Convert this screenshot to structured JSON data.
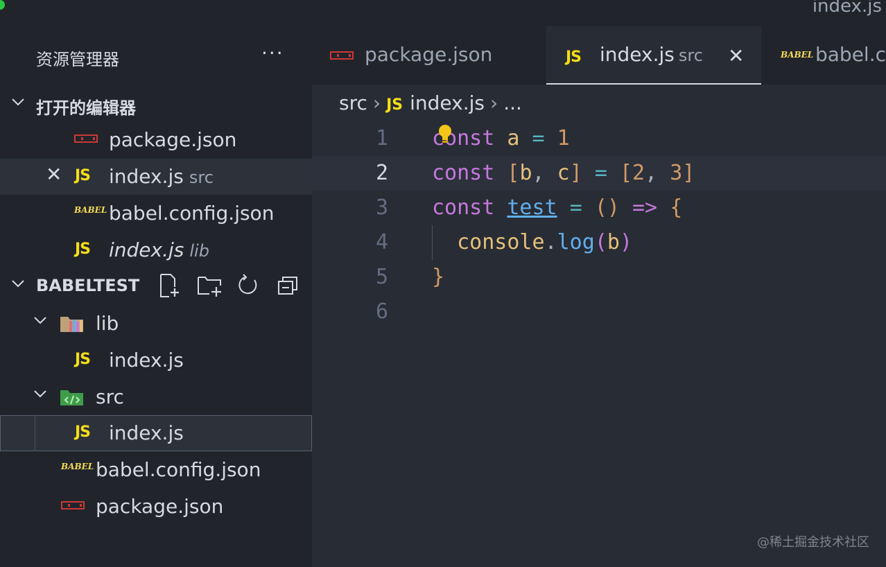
{
  "window": {
    "title": "index.js"
  },
  "sidebar": {
    "title": "资源管理器",
    "more_label": "···",
    "open_editors": {
      "label": "打开的编辑器",
      "items": [
        {
          "name": "package.json",
          "desc": "",
          "icon": "npm-icon"
        },
        {
          "name": "index.js",
          "desc": "src",
          "icon": "js-icon"
        },
        {
          "name": "babel.config.json",
          "desc": "",
          "icon": "babel-icon"
        },
        {
          "name": "index.js",
          "desc": "lib",
          "icon": "js-icon"
        }
      ]
    },
    "project": {
      "label": "BABELTEST",
      "tree": [
        {
          "name": "lib",
          "type": "folder"
        },
        {
          "name": "index.js",
          "type": "file"
        },
        {
          "name": "src",
          "type": "folder"
        },
        {
          "name": "index.js",
          "type": "file"
        },
        {
          "name": "babel.config.json",
          "type": "file"
        },
        {
          "name": "package.json",
          "type": "file"
        }
      ]
    }
  },
  "tabs": [
    {
      "name": "package.json",
      "desc": ""
    },
    {
      "name": "index.js",
      "desc": "src"
    },
    {
      "name": "babel.config.json",
      "desc": ""
    }
  ],
  "icons": {
    "js": "JS",
    "babel": "BABEL",
    "close": "✕",
    "chevron": "›",
    "chevron_down": "⌄"
  },
  "breadcrumb": {
    "folder": "src",
    "file": "index.js",
    "more": "..."
  },
  "editor": {
    "line_numbers": [
      "1",
      "2",
      "3",
      "4",
      "5",
      "6"
    ],
    "current_line": 2,
    "lines": [
      "const a = 1",
      "const [b, c] = [2, 3]",
      "const test = () => {",
      "  console.log(b)",
      "}",
      ""
    ]
  },
  "watermark": "@稀土掘金技术社区",
  "colors": {
    "sidebar_bg": "#21252b",
    "editor_bg": "#282c34",
    "keyword": "#c678dd",
    "variable": "#e5c07b",
    "js_icon": "#f5de19",
    "npm_icon": "#cb3837"
  }
}
